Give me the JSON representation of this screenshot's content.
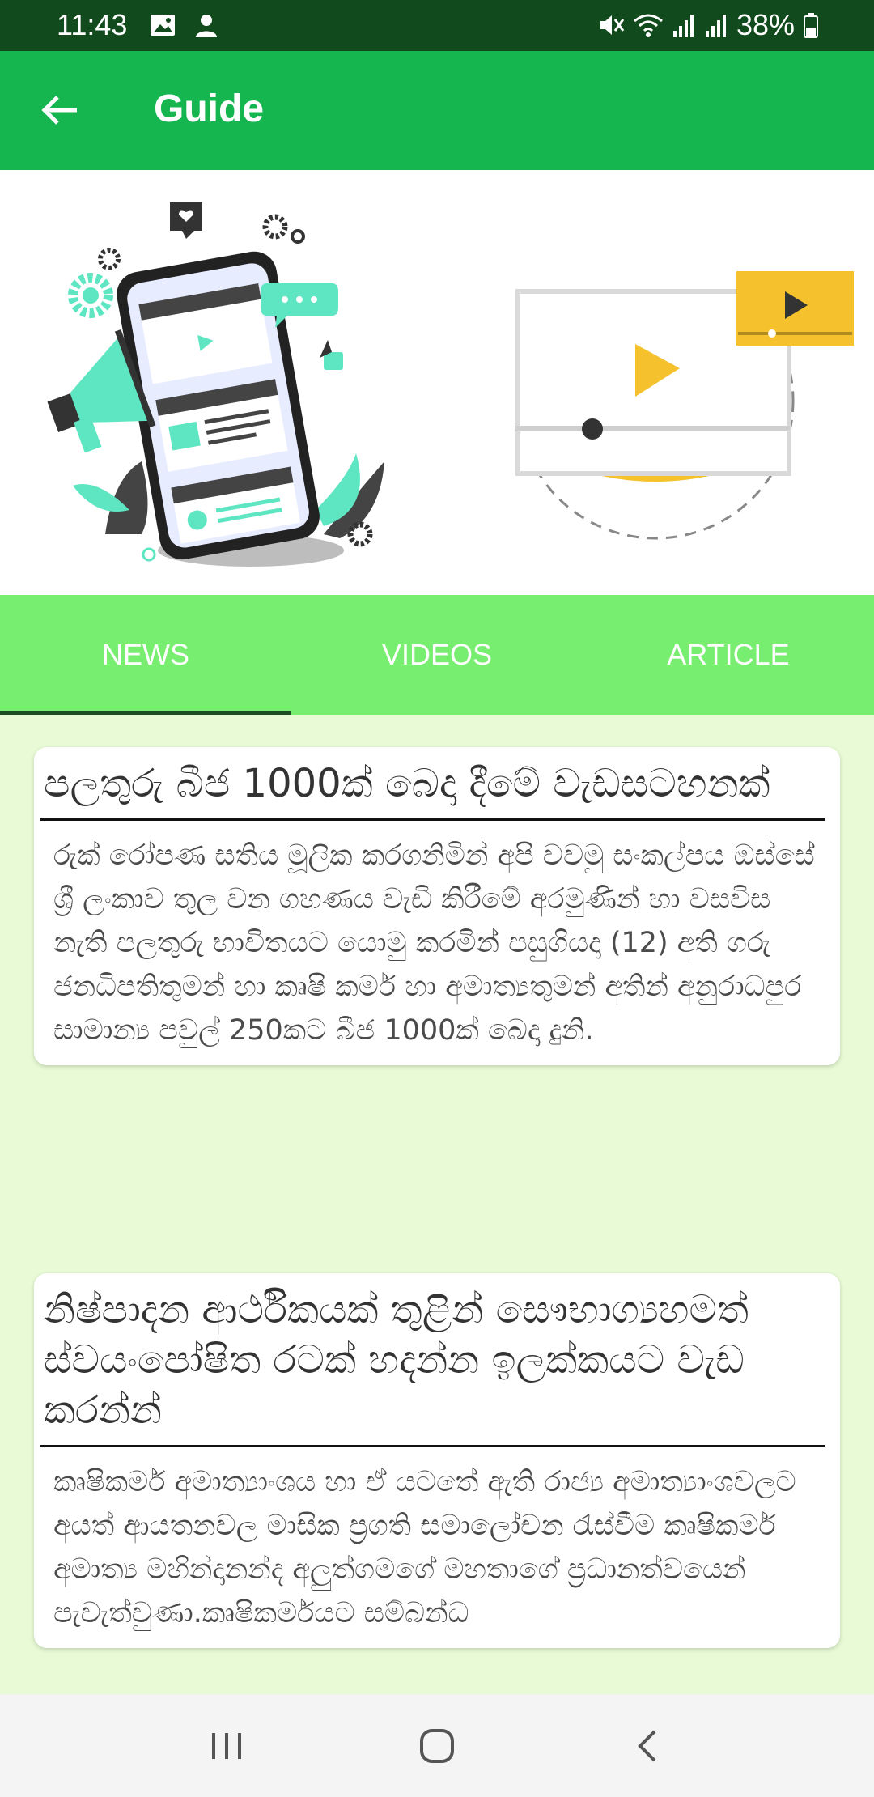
{
  "status": {
    "time": "11:43",
    "battery": "38%"
  },
  "app_bar": {
    "title": "Guide",
    "back_icon": "arrow-left-icon"
  },
  "tabs": [
    {
      "label": "NEWS",
      "active": true
    },
    {
      "label": "VIDEOS",
      "active": false
    },
    {
      "label": "ARTICLE",
      "active": false
    }
  ],
  "articles": [
    {
      "title": "පලතුරු බීජ 1000ක් බෙදා දීමේ වැඩසටහනක්",
      "body": "රුක් රෝපණ සතිය මූලික කරගනිමින් අපි වවමු සංකල්පය ඔස්සේ ශ්‍රී ලංකාව තුල වන ගහණය වැඩි කිරීමේ අරමුණින් හා වසවිස නැති පලතුරු භාවිතයට යොමු කරමින් පසුගියදා (12) අති ගරු ජනධිපතිතුමන් හා කෘෂි කර්ම හා අමාත්‍යතුමන් අතින් අනුරාධපුර සාමාන්‍ය පවුල් 250කට බීජ 1000ක් බෙදා දුනි."
    },
    {
      "title": "නිෂ්පාදන ආර්ථිකයක් තුළින් සෞභාග්‍යහමත් ස්වයංපෝෂිත රටක් හදන්න ඉලක්කයට වැඩ කරන්න්",
      "body": "කෘෂිකර්ම අමාත්‍යාංශය හා ඒ යටතේ ඇති රාජ්‍ය අමාත්‍යාංශවලට අයත් ආයතනවල මාසික ප්‍රගති සමාලෝචන රැස්වීම කෘෂිකර්ම අමාත්‍ය මහින්දානන්ද අලුත්ගමගේ මහතාගේ ප්‍රධානත්වයෙන් පැවැත්වුණා.කෘෂිකර්මයට සම්බන්ධ"
    }
  ],
  "colors": {
    "status_bar": "#114a1c",
    "app_bar": "#15b550",
    "tabs_bg": "#77ee70",
    "content_bg": "#e8fbd6",
    "tab_indicator": "#1d4d24"
  },
  "nav": {
    "recents_icon": "recents-icon",
    "home_icon": "home-icon",
    "back_icon": "back-chevron-icon"
  }
}
